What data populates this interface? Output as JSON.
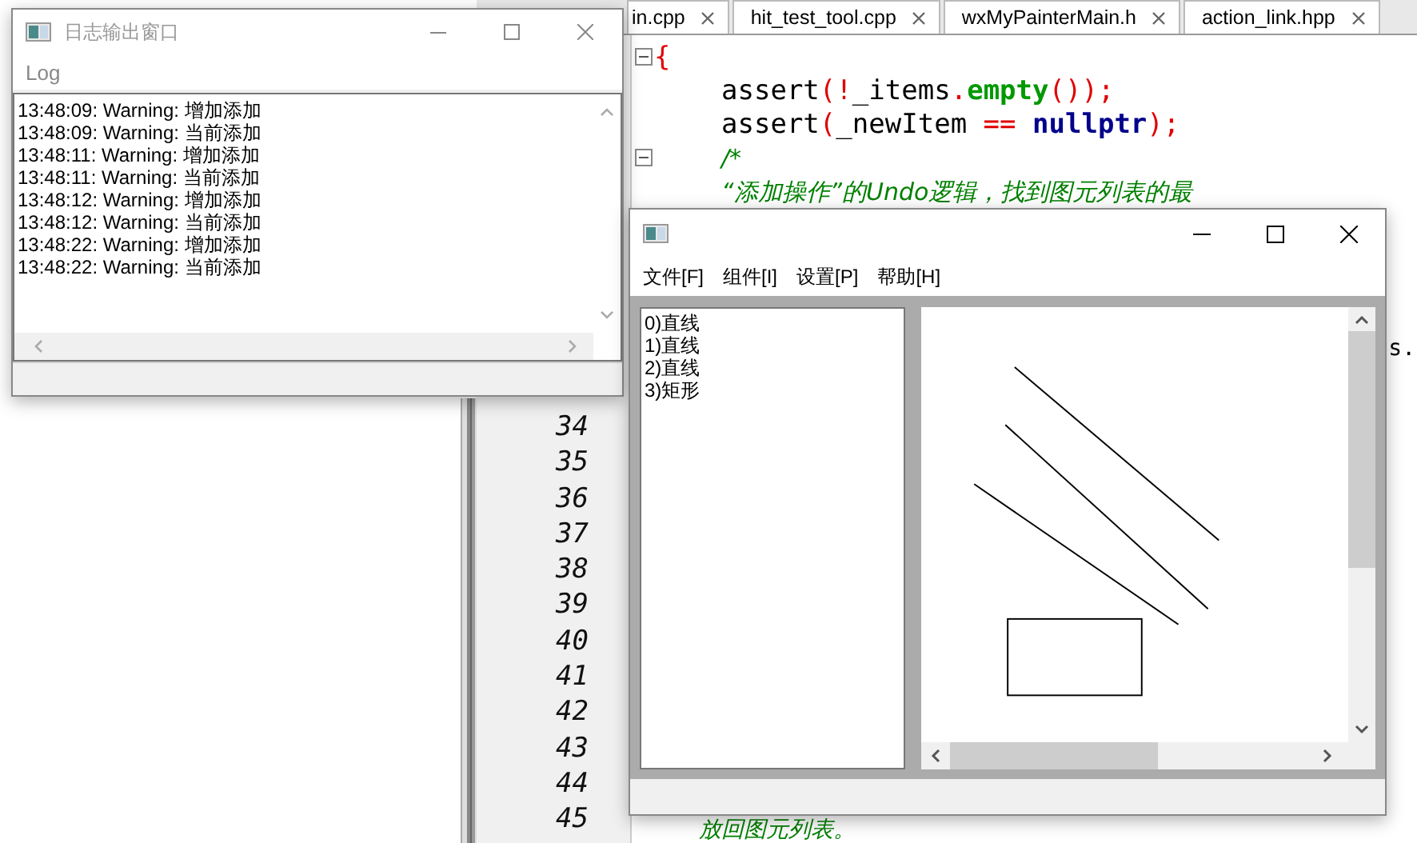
{
  "editor": {
    "tabs": [
      {
        "label": "in.cpp"
      },
      {
        "label": "hit_test_tool.cpp"
      },
      {
        "label": "wxMyPainterMain.h"
      },
      {
        "label": "action_link.hpp"
      }
    ],
    "code_lines": [
      {
        "fold": true,
        "indented": false,
        "tokens": [
          {
            "text": "{",
            "kind": "punct"
          }
        ]
      },
      {
        "fold": false,
        "indented": true,
        "tokens": [
          {
            "text": "assert",
            "kind": "plain"
          },
          {
            "text": "(!",
            "kind": "punct"
          },
          {
            "text": "_items",
            "kind": "plain"
          },
          {
            "text": ".",
            "kind": "punct"
          },
          {
            "text": "empty",
            "kind": "method"
          },
          {
            "text": "());",
            "kind": "punct"
          }
        ]
      },
      {
        "fold": false,
        "indented": true,
        "tokens": [
          {
            "text": "assert",
            "kind": "plain"
          },
          {
            "text": "(",
            "kind": "punct"
          },
          {
            "text": "_newItem ",
            "kind": "plain"
          },
          {
            "text": "==",
            "kind": "punct"
          },
          {
            "text": " nullptr",
            "kind": "keyword"
          },
          {
            "text": ");",
            "kind": "punct"
          }
        ]
      },
      {
        "fold": true,
        "indented": true,
        "tokens": [
          {
            "text": "/*",
            "kind": "comment"
          }
        ]
      },
      {
        "fold": false,
        "indented": true,
        "tokens": [
          {
            "text": "“添加操作”的Undo逻辑，找到图元列表的最",
            "kind": "comment"
          }
        ]
      }
    ],
    "line_numbers": [
      "34",
      "35",
      "36",
      "37",
      "38",
      "39",
      "40",
      "41",
      "42",
      "43",
      "44",
      "45"
    ],
    "fragment_right": "s.",
    "bottom_line": "放回图元列表。"
  },
  "log_window": {
    "title": "日志输出窗口",
    "active": false,
    "menu": [
      "Log"
    ],
    "entries": [
      "13:48:09: Warning: 增加添加",
      "13:48:09: Warning: 当前添加",
      "13:48:11: Warning: 增加添加",
      "13:48:11: Warning: 当前添加",
      "13:48:12: Warning: 增加添加",
      "13:48:12: Warning: 当前添加",
      "13:48:22: Warning: 增加添加",
      "13:48:22: Warning: 当前添加"
    ]
  },
  "painter_window": {
    "menu": [
      "文件[F]",
      "组件[I]",
      "设置[P]",
      "帮助[H]"
    ],
    "shapes": [
      {
        "label": "0)直线",
        "kind": "line"
      },
      {
        "label": "1)直线",
        "kind": "line"
      },
      {
        "label": "2)直线",
        "kind": "line"
      },
      {
        "label": "3)矩形",
        "kind": "rect"
      }
    ]
  }
}
